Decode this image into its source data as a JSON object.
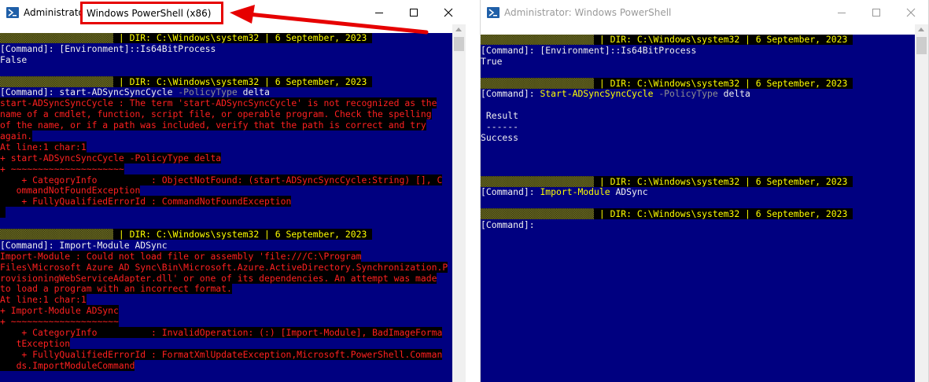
{
  "left_window": {
    "title_prefix": "Administrator",
    "title_app": "Windows PowerShell (x86)",
    "lines": [
      [
        {
          "t": "▒▒▒▒▒▒▒▒▒▒▒▒▒▒▒▒▒▒▒▒▒",
          "c": "user"
        },
        {
          "t": " | DIR: C:\\Windows\\system32 | 6 September, 2023 ",
          "c": "prompt"
        }
      ],
      [
        {
          "t": "[Command]: [Environment]::Is64BitProcess",
          "c": "plain"
        }
      ],
      [
        {
          "t": "False",
          "c": "plain"
        }
      ],
      [
        {
          "t": "",
          "c": "plain"
        }
      ],
      [
        {
          "t": "▒▒▒▒▒▒▒▒▒▒▒▒▒▒▒▒▒▒▒▒▒",
          "c": "user"
        },
        {
          "t": " | DIR: C:\\Windows\\system32 | 6 September, 2023 ",
          "c": "prompt"
        }
      ],
      [
        {
          "t": "[Command]: start-ADSyncSyncCycle ",
          "c": "plain"
        },
        {
          "t": "-PolicyType",
          "c": "param"
        },
        {
          "t": " delta",
          "c": "plain"
        }
      ],
      [
        {
          "t": "start-ADSyncSyncCycle : The term 'start-ADSyncSyncCycle' is not recognized as the",
          "c": "err"
        }
      ],
      [
        {
          "t": "name of a cmdlet, function, script file, or operable program. Check the spelling",
          "c": "err"
        }
      ],
      [
        {
          "t": "of the name, or if a path was included, verify that the path is correct and try",
          "c": "err"
        }
      ],
      [
        {
          "t": "again.",
          "c": "err"
        }
      ],
      [
        {
          "t": "At line:1 char:1",
          "c": "err"
        }
      ],
      [
        {
          "t": "+ start-ADSyncSyncCycle -PolicyType delta",
          "c": "err"
        }
      ],
      [
        {
          "t": "+ ~~~~~~~~~~~~~~~~~~~~~",
          "c": "err"
        }
      ],
      [
        {
          "t": "    + CategoryInfo          : ObjectNotFound: (start-ADSyncSyncCycle:String) [], C",
          "c": "err"
        }
      ],
      [
        {
          "t": "   ommandNotFoundException",
          "c": "err"
        }
      ],
      [
        {
          "t": "    + FullyQualifiedErrorId : CommandNotFoundException",
          "c": "err"
        }
      ],
      [
        {
          "t": " ",
          "c": "err"
        }
      ],
      [
        {
          "t": "",
          "c": "plain"
        }
      ],
      [
        {
          "t": "▒▒▒▒▒▒▒▒▒▒▒▒▒▒▒▒▒▒▒▒▒",
          "c": "user"
        },
        {
          "t": " | DIR: C:\\Windows\\system32 | 6 September, 2023 ",
          "c": "prompt"
        }
      ],
      [
        {
          "t": "[Command]: Import-Module ADSync",
          "c": "plain"
        }
      ],
      [
        {
          "t": "Import-Module : Could not load file or assembly 'file:///C:\\Program",
          "c": "err"
        }
      ],
      [
        {
          "t": "Files\\Microsoft Azure AD Sync\\Bin\\Microsoft.Azure.ActiveDirectory.Synchronization.P",
          "c": "err"
        }
      ],
      [
        {
          "t": "rovisioningWebServiceAdapter.dll' or one of its dependencies. An attempt was made",
          "c": "err"
        }
      ],
      [
        {
          "t": "to load a program with an incorrect format.",
          "c": "err"
        }
      ],
      [
        {
          "t": "At line:1 char:1",
          "c": "err"
        }
      ],
      [
        {
          "t": "+ Import-Module ADSync",
          "c": "err"
        }
      ],
      [
        {
          "t": "+ ~~~~~~~~~~~~~~~~~~~~",
          "c": "err"
        }
      ],
      [
        {
          "t": "    + CategoryInfo          : InvalidOperation: (:) [Import-Module], BadImageForma",
          "c": "err"
        }
      ],
      [
        {
          "t": "   tException",
          "c": "err"
        }
      ],
      [
        {
          "t": "    + FullyQualifiedErrorId : FormatXmlUpdateException,Microsoft.PowerShell.Comman",
          "c": "err"
        }
      ],
      [
        {
          "t": "   ds.ImportModuleCommand",
          "c": "err"
        }
      ]
    ]
  },
  "right_window": {
    "title_prefix": "Administrator: ",
    "title_app": "Windows PowerShell",
    "lines": [
      [
        {
          "t": "▒▒▒▒▒▒▒▒▒▒▒▒▒▒▒▒▒▒▒▒▒",
          "c": "user"
        },
        {
          "t": " | DIR: C:\\Windows\\system32 | 6 September, 2023 ",
          "c": "prompt"
        }
      ],
      [
        {
          "t": "[Command]: [Environment]::Is64BitProcess",
          "c": "plain"
        }
      ],
      [
        {
          "t": "True",
          "c": "plain"
        }
      ],
      [
        {
          "t": "",
          "c": "plain"
        }
      ],
      [
        {
          "t": "▒▒▒▒▒▒▒▒▒▒▒▒▒▒▒▒▒▒▒▒▒",
          "c": "user"
        },
        {
          "t": " | DIR: C:\\Windows\\system32 | 6 September, 2023 ",
          "c": "prompt"
        }
      ],
      [
        {
          "t": "[Command]: ",
          "c": "plain"
        },
        {
          "t": "Start-ADSyncSyncCycle",
          "c": "cmdword"
        },
        {
          "t": " ",
          "c": "plain"
        },
        {
          "t": "-PolicyType",
          "c": "param"
        },
        {
          "t": " delta",
          "c": "plain"
        }
      ],
      [
        {
          "t": "",
          "c": "plain"
        }
      ],
      [
        {
          "t": " Result",
          "c": "plain"
        }
      ],
      [
        {
          "t": " ------",
          "c": "plain"
        }
      ],
      [
        {
          "t": "Success",
          "c": "plain"
        }
      ],
      [
        {
          "t": "",
          "c": "plain"
        }
      ],
      [
        {
          "t": "",
          "c": "plain"
        }
      ],
      [
        {
          "t": "",
          "c": "plain"
        }
      ],
      [
        {
          "t": "▒▒▒▒▒▒▒▒▒▒▒▒▒▒▒▒▒▒▒▒▒",
          "c": "user"
        },
        {
          "t": " | DIR: C:\\Windows\\system32 | 6 September, 2023 ",
          "c": "prompt"
        }
      ],
      [
        {
          "t": "[Command]: ",
          "c": "plain"
        },
        {
          "t": "Import-Module",
          "c": "cmdword"
        },
        {
          "t": " ADSync",
          "c": "plain"
        }
      ],
      [
        {
          "t": "",
          "c": "plain"
        }
      ],
      [
        {
          "t": "▒▒▒▒▒▒▒▒▒▒▒▒▒▒▒▒▒▒▒▒▒",
          "c": "user"
        },
        {
          "t": " | DIR: C:\\Windows\\system32 | 6 September, 2023 ",
          "c": "prompt"
        }
      ],
      [
        {
          "t": "[Command]: ",
          "c": "plain"
        }
      ]
    ]
  },
  "colors": {
    "console_bg": "#000080",
    "prompt_fg": "#ffff00",
    "error_fg": "#ff2020",
    "highlight": "#e60000"
  },
  "icons": {
    "app": "powershell-icon",
    "minimize": "minimize-icon",
    "maximize": "maximize-icon",
    "close": "close-icon",
    "annotation": "red-arrow-icon"
  }
}
